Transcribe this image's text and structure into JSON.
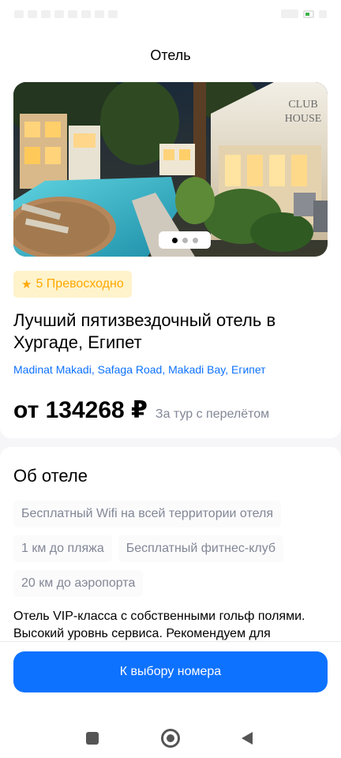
{
  "header": {
    "title": "Отель"
  },
  "gallery": {
    "total_images": 3,
    "active_index": 0,
    "sign_text": "CLUB HOUSE"
  },
  "hotel": {
    "rating_label": "5 Превосходно",
    "rating_icon": "star-icon",
    "name": "Лучший пятизвездочный отель в Хургаде, Египет",
    "address": "Madinat Makadi, Safaga Road, Makadi Bay, Египет",
    "price": "от 134268 ₽",
    "price_note": "За тур с перелётом"
  },
  "about": {
    "title": "Об отеле",
    "features": [
      "Бесплатный Wifi на всей территории отеля",
      "1 км до пляжа",
      "Бесплатный фитнес-клуб",
      "20 км до аэропорта"
    ],
    "description": "Отель VIP-класса с собственными гольф полями. Высокий уровнь сервиса. Рекомендуем для"
  },
  "footer": {
    "cta_label": "К выбору номера"
  },
  "colors": {
    "accent": "#0D72FF",
    "rating_text": "#FFA800",
    "rating_bg": "#FFF3CC",
    "muted_text": "#828796",
    "chip_bg": "#FBFBFC",
    "page_bg": "#F6F6F9"
  }
}
